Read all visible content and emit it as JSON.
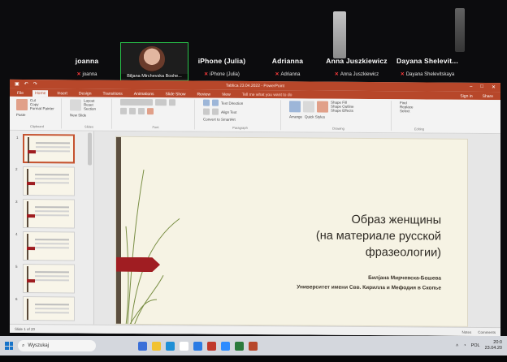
{
  "zoom": {
    "participants": [
      {
        "big": "joanna",
        "small": "joanna"
      },
      {
        "video_label": "Biljana Mirchevska Boshe..."
      },
      {
        "big": "iPhone (Julia)",
        "small": "iPhone (Julia)"
      },
      {
        "big": "Adrianna",
        "small": "Adrianna"
      },
      {
        "big": "Anna Juszkiewicz",
        "small": "Anna Juszkiewicz"
      },
      {
        "big": "Dayana Shelevit...",
        "small": "Dayana Shelevitskaya"
      }
    ],
    "mic_icon": "muted-mic-icon"
  },
  "powerpoint": {
    "window_title": "Tablica 23.04.2022 - PowerPoint",
    "tabs": [
      "File",
      "Home",
      "Insert",
      "Design",
      "Transitions",
      "Animations",
      "Slide Show",
      "Review",
      "View"
    ],
    "tell_me": "Tell me what you want to do",
    "signin": "Sign in",
    "share": "Share",
    "ribbon": {
      "clipboard": {
        "name": "Clipboard",
        "items": [
          "Cut",
          "Copy",
          "Format Painter"
        ],
        "paste": "Paste"
      },
      "slides": {
        "name": "Slides",
        "items": [
          "New Slide",
          "Layout",
          "Reset",
          "Section"
        ]
      },
      "font": {
        "name": "Font"
      },
      "paragraph": {
        "name": "Paragraph",
        "items": [
          "Text Direction",
          "Align Text",
          "Convert to SmartArt"
        ]
      },
      "drawing": {
        "name": "Drawing",
        "items": [
          "Shape Fill",
          "Shape Outline",
          "Shape Effects",
          "Arrange",
          "Quick Styles"
        ]
      },
      "editing": {
        "name": "Editing",
        "items": [
          "Find",
          "Replace",
          "Select"
        ]
      }
    },
    "slide_numbers": [
      "1",
      "2",
      "3",
      "4",
      "5",
      "6"
    ],
    "slide": {
      "title_line1": "Образ женщины",
      "title_line2": "(на материале русской",
      "title_line3": "фразеологии)",
      "author": "Билјана Мирчевска-Бошева",
      "university": "Университет имени Свв. Кирилла и Мефодия в Скопье"
    },
    "status": {
      "slide_of": "Slide 1 of 20",
      "notes": "Notes",
      "comments": "Comments"
    }
  },
  "taskbar": {
    "search_placeholder": "Wyszukaj",
    "lang": "POL",
    "time": "20:0",
    "date": "23.04.20"
  }
}
